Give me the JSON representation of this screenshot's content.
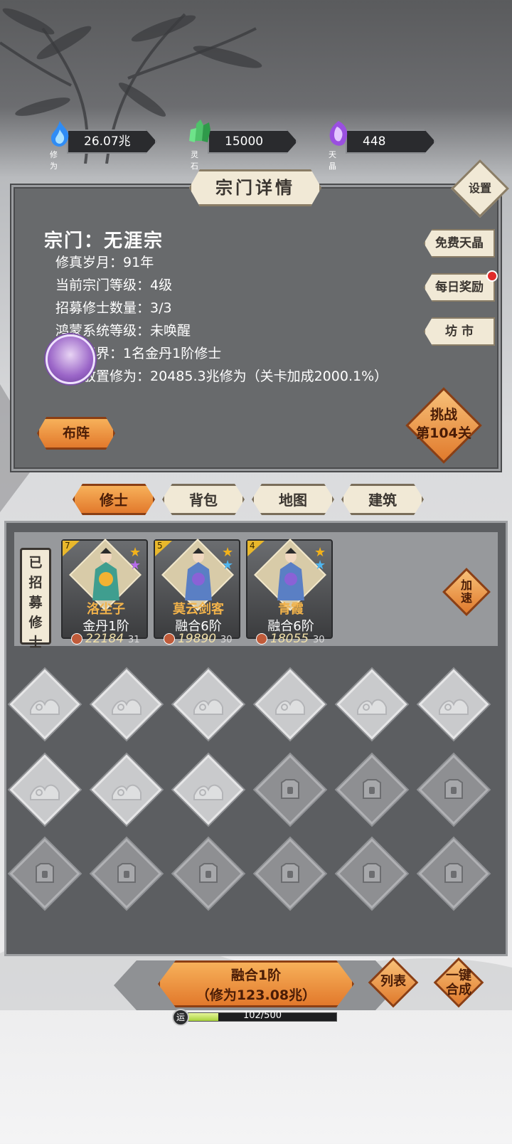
{
  "resources": [
    {
      "label": "修为",
      "value": "26.07兆",
      "icon": "blue-flame-icon"
    },
    {
      "label": "灵石",
      "value": "15000",
      "icon": "green-crystal-icon"
    },
    {
      "label": "天晶",
      "value": "448",
      "icon": "purple-gem-icon"
    }
  ],
  "header": {
    "title": "宗门详情",
    "settings_label": "设置"
  },
  "sect": {
    "name": "宗门：无涯宗",
    "info": [
      {
        "key": "修真岁月：",
        "value": "91年"
      },
      {
        "key": "当前宗门等级：",
        "value": "4级"
      },
      {
        "key": "招募修士数量：",
        "value": "3/3"
      },
      {
        "key": "鸿蒙系统等级：",
        "value": "未唤醒"
      },
      {
        "key": "最高境界：",
        "value": "1名金丹1阶修士"
      },
      {
        "key": "每日放置修为：",
        "value": "20485.3兆修为（关卡加成2000.1%）"
      }
    ]
  },
  "side_buttons": [
    "免费天晶",
    "每日奖励",
    "坊 市"
  ],
  "buzhen_label": "布阵",
  "challenge": {
    "line1": "挑战",
    "line2": "第104关"
  },
  "tabs": [
    "修士",
    "背包",
    "地图",
    "建筑"
  ],
  "recruit_tag": "已招募修士",
  "cultivators": [
    {
      "level": "7",
      "name": "洛尘子",
      "realm": "金丹1阶",
      "power": "22184",
      "count": "31",
      "star2_color": "#b76bea"
    },
    {
      "level": "5",
      "name": "莫云剑客",
      "realm": "融合6阶",
      "power": "19890",
      "count": "30",
      "star2_color": "#4fb6f0"
    },
    {
      "level": "4",
      "name": "青霞",
      "realm": "融合6阶",
      "power": "18055",
      "count": "30",
      "star2_color": "#4fb6f0"
    }
  ],
  "speedup_label": "加速",
  "slots": [
    "empty",
    "empty",
    "empty",
    "empty",
    "empty",
    "empty",
    "empty",
    "empty",
    "empty",
    "locked",
    "locked",
    "locked",
    "locked",
    "locked",
    "locked",
    "locked",
    "locked",
    "locked"
  ],
  "merge": {
    "line1": "融合1阶",
    "line2": "（修为123.08兆）"
  },
  "list_label": "列表",
  "one_click_label": "一键合成",
  "luck": {
    "icon_label": "运",
    "text": "102/500",
    "progress": 0.204
  },
  "colors": {
    "accent_orange": "#e2792c",
    "panel_gray": "#686a6c",
    "parchment": "#f1e9d6"
  }
}
